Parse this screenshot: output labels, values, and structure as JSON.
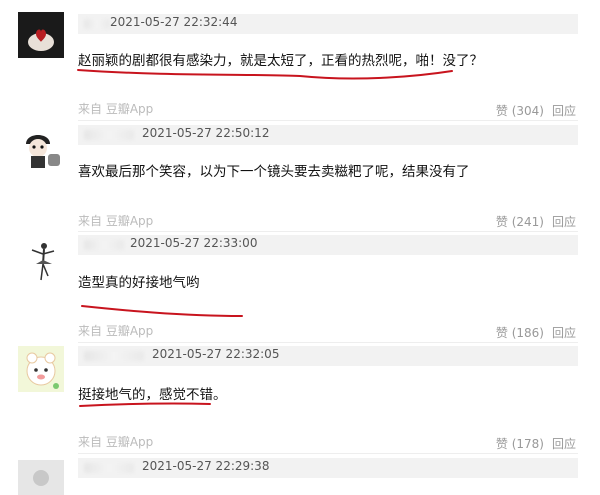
{
  "comments": [
    {
      "timestamp": "2021-05-27 22:32:44",
      "text": "赵丽颖的剧都很有感染力，就是太短了，正看的热烈呢，啪！没了？",
      "source": "来自 豆瓣App",
      "like_count": "赞 (304)",
      "reply": "回应",
      "avatar_icon": "dark-heart-hand-avatar"
    },
    {
      "timestamp": "2021-05-27 22:50:12",
      "text": "喜欢最后那个笑容，以为下一个镜头要去卖糍粑了呢，结果没有了",
      "source": "来自 豆瓣App",
      "like_count": "赞 (241)",
      "reply": "回应",
      "avatar_icon": "cartoon-character-avatar"
    },
    {
      "timestamp": "2021-05-27 22:33:00",
      "text": "造型真的好接地气哟",
      "source": "来自 豆瓣App",
      "like_count": "赞 (186)",
      "reply": "回应",
      "avatar_icon": "ballet-dancer-avatar"
    },
    {
      "timestamp": "2021-05-27 22:32:05",
      "text": "挺接地气的，感觉不错。",
      "source": "来自 豆瓣App",
      "like_count": "赞 (178)",
      "reply": "回应",
      "avatar_icon": "cute-cartoon-avatar"
    },
    {
      "timestamp": "2021-05-27 22:29:38",
      "avatar_icon": "default-user-avatar"
    }
  ],
  "colors": {
    "underline_red": "#c8141e",
    "meta_bar_bg": "#f2f2f2",
    "source_text": "#bbbbbb",
    "action_text": "#999999"
  }
}
